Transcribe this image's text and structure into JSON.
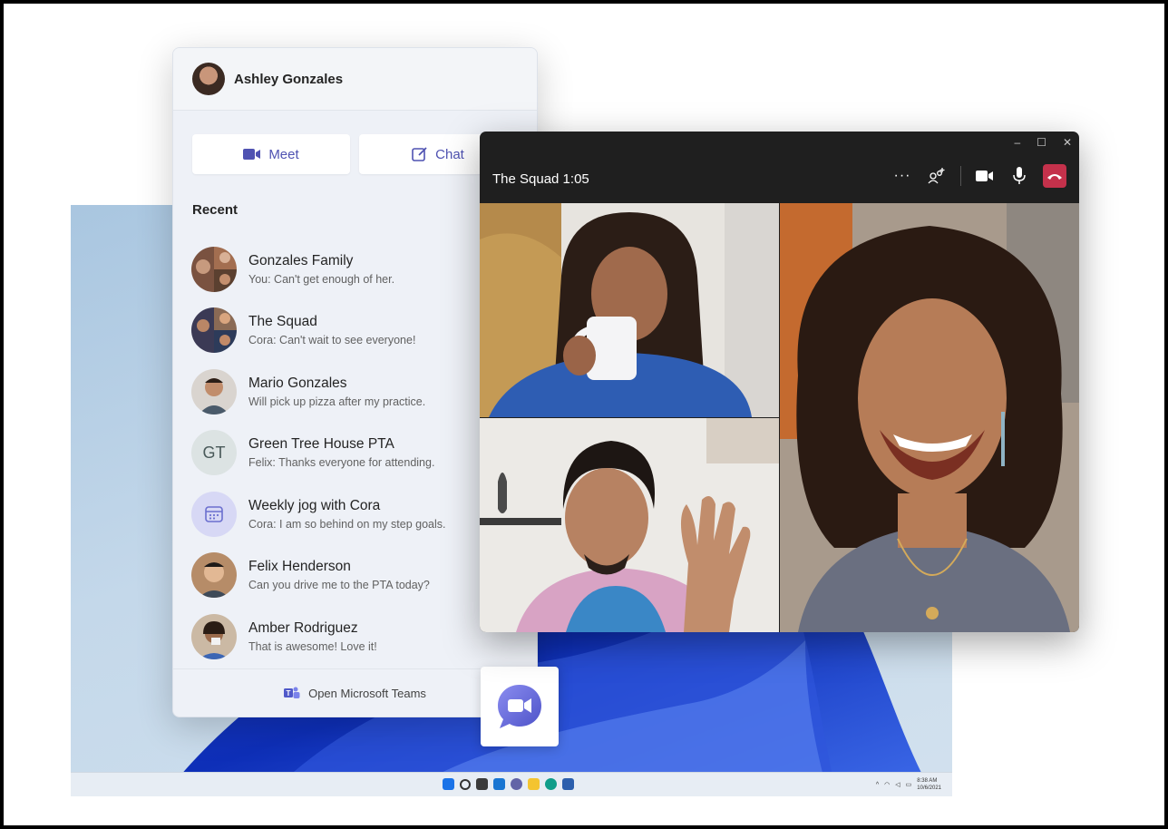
{
  "flyout": {
    "user_name": "Ashley Gonzales",
    "buttons": [
      {
        "label": "Meet",
        "icon": "video-camera-icon"
      },
      {
        "label": "Chat",
        "icon": "compose-icon"
      }
    ],
    "recent_label": "Recent",
    "conversations": [
      {
        "name": "Gonzales Family",
        "preview": "You: Can't get enough of her.",
        "avatar": "group-photo"
      },
      {
        "name": "The Squad",
        "preview": "Cora: Can't wait to see everyone!",
        "avatar": "group-photo"
      },
      {
        "name": "Mario Gonzales",
        "preview": "Will pick up pizza after my practice.",
        "avatar": "photo"
      },
      {
        "name": "Green Tree House PTA",
        "preview": "Felix: Thanks everyone for attending.",
        "avatar": "initials",
        "initials": "GT"
      },
      {
        "name": "Weekly jog with Cora",
        "preview": "Cora: I am so behind on my step goals.",
        "avatar": "calendar-icon"
      },
      {
        "name": "Felix Henderson",
        "preview": "Can you drive me to the PTA today?",
        "avatar": "photo"
      },
      {
        "name": "Amber Rodriguez",
        "preview": "That is awesome! Love it!",
        "avatar": "photo"
      }
    ],
    "footer_label": "Open Microsoft Teams",
    "footer_icon": "teams-logo-icon"
  },
  "call": {
    "title": "The Squad 1:05",
    "tools": [
      "more-options-icon",
      "add-people-icon",
      "camera-icon",
      "microphone-icon",
      "hang-up-icon"
    ],
    "window_controls": [
      "minimize-icon",
      "maximize-icon",
      "close-icon"
    ]
  },
  "taskbar": {
    "icons": [
      "start-icon",
      "search-icon",
      "task-view-icon",
      "widgets-icon",
      "chat-icon",
      "file-explorer-icon",
      "edge-icon",
      "store-icon"
    ],
    "time": "8:38 AM",
    "date": "10/6/2021"
  },
  "colors": {
    "accent": "#4f52b2",
    "hangup": "#c4314b",
    "flyout_bg": "#eef1f7",
    "call_bg": "#1f1f1f"
  }
}
